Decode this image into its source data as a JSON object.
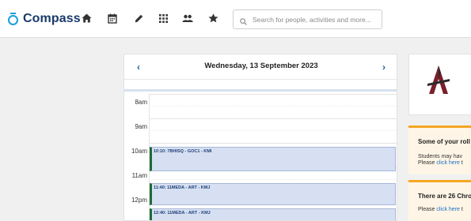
{
  "nav": {
    "logo_text": "Compass",
    "icons": [
      "home-icon",
      "calendar-icon",
      "pencil-icon",
      "grid-icon",
      "people-icon",
      "star-icon"
    ],
    "search_placeholder": "Search for people, activities and more...",
    "accent_color": "#1a9fd8",
    "brand_color": "#1a3a6b"
  },
  "calendar": {
    "date_title": "Wednesday, 13 September 2023",
    "prev_label": "‹",
    "next_label": "›",
    "hours": [
      "8am",
      "9am",
      "10am",
      "11am",
      "12pm"
    ],
    "events": [
      {
        "label": "10:10: 7BHISQ - GOC1 - KMI"
      },
      {
        "label": "11:40: 11MEDA - ART - KMJ"
      },
      {
        "label": "12:40: 11MEDA - ART - KMJ"
      }
    ]
  },
  "alerts": {
    "roll": {
      "title": "Some of your roll",
      "line1": "Students may hav",
      "line2_prefix": "Please ",
      "line2_link": "click here",
      "line2_suffix": " t"
    },
    "chronicle": {
      "title": "There are 26 Chro",
      "line1_prefix": "Please ",
      "line1_link": "click here",
      "line1_suffix": " t"
    },
    "alert_color": "#f5a623"
  }
}
